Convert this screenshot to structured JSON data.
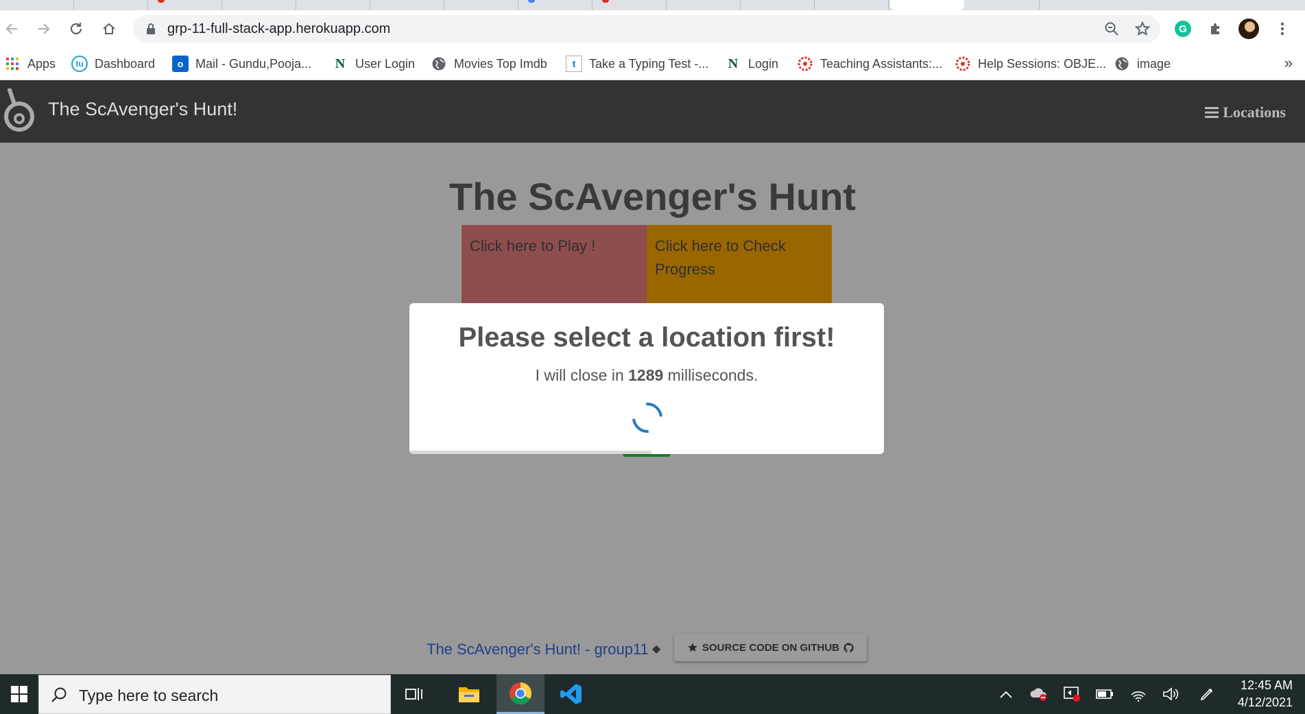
{
  "browser": {
    "url": "grp-11-full-stack-app.herokuapp.com",
    "bookmarks": [
      {
        "label": "Apps",
        "icon": "apps-grid-icon"
      },
      {
        "label": "Dashboard",
        "icon": "tu-icon"
      },
      {
        "label": "Mail - Gundu,Pooja...",
        "icon": "outlook-icon"
      },
      {
        "label": "User Login",
        "icon": "n-logo-icon"
      },
      {
        "label": "Movies Top Imdb",
        "icon": "globe-icon"
      },
      {
        "label": "Take a Typing Test -...",
        "icon": "t-logo-icon"
      },
      {
        "label": "Login",
        "icon": "n-logo-icon"
      },
      {
        "label": "Teaching Assistants:...",
        "icon": "canvas-icon"
      },
      {
        "label": "Help Sessions: OBJE...",
        "icon": "canvas-icon"
      },
      {
        "label": "image",
        "icon": "globe-icon"
      }
    ],
    "more": "»"
  },
  "app": {
    "brand": "The ScAvenger's Hunt!",
    "nav_locations": "Locations",
    "title": "The ScAvenger's Hunt",
    "tile_play": "Click here to Play !",
    "tile_progress": "Click here to Check Progress",
    "footer_link": "The ScAvenger's Hunt! - group11",
    "footer_separator": "◆",
    "github_button": "SOURCE CODE ON GITHUB"
  },
  "modal": {
    "title": "Please select a location first!",
    "text_before": "I will close in ",
    "countdown": "1289",
    "text_after": " milliseconds.",
    "timer_progress": 0.51
  },
  "taskbar": {
    "search_placeholder": "Type here to search",
    "time": "12:45 AM",
    "date": "4/12/2021"
  }
}
